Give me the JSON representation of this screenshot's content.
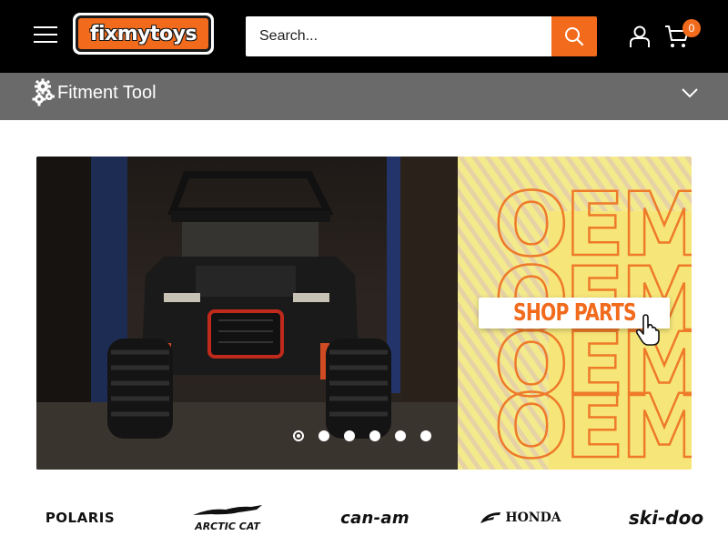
{
  "header": {
    "logo_text": "fixmytoys",
    "search": {
      "placeholder": "Search..."
    },
    "cart_count": "0",
    "brand_color": "#f26b1d",
    "background": "#000000",
    "icons": [
      "menu-icon",
      "search-icon",
      "account-icon",
      "cart-icon"
    ]
  },
  "fitment": {
    "label": "Fitment Tool",
    "icon": "gears-icon",
    "toggle_icon": "chevron-down-icon",
    "background": "#6a6a6a"
  },
  "hero": {
    "art_words": [
      "OEM",
      "OEM",
      "OEM",
      "OEM"
    ],
    "cta_label": "SHOP PARTS",
    "slide_count": 6,
    "active_slide": 1
  },
  "brands": [
    {
      "name": "POLARIS"
    },
    {
      "name": "ARCTIC CAT"
    },
    {
      "name": "can-am"
    },
    {
      "name": "HONDA"
    },
    {
      "name": "ski-doo"
    }
  ]
}
